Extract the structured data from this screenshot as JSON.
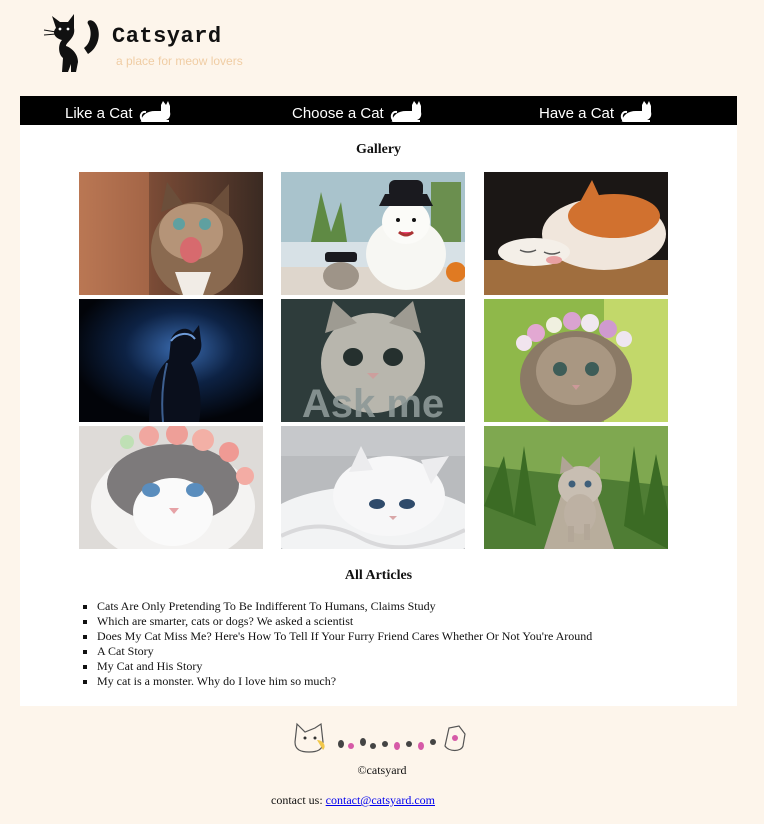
{
  "header": {
    "brand": "Catsyard",
    "tagline": "a place for meow lovers"
  },
  "nav": {
    "items": [
      {
        "label": "Like a Cat"
      },
      {
        "label": "Choose a Cat"
      },
      {
        "label": "Have a Cat"
      }
    ]
  },
  "gallery": {
    "title": "Gallery"
  },
  "articles": {
    "title": "All Articles",
    "items": [
      "Cats Are Only Pretending To Be Indifferent To Humans, Claims Study",
      "Which are smarter, cats or dogs? We asked a scientist",
      "Does My Cat Miss Me? Here's How To Tell If Your Furry Friend Cares Whether Or Not You're Around",
      "A Cat Story",
      "My Cat and His Story",
      "My cat is a monster. Why do I love him so much?"
    ]
  },
  "footer": {
    "copyright": "©catsyard",
    "contact_label": "contact us:",
    "contact_email": "contact@catsyard.com"
  },
  "colors": {
    "page_bg": "#fdf5eb",
    "nav_bg": "#000000",
    "tagline": "#f0cda4",
    "link": "#0000ee"
  }
}
